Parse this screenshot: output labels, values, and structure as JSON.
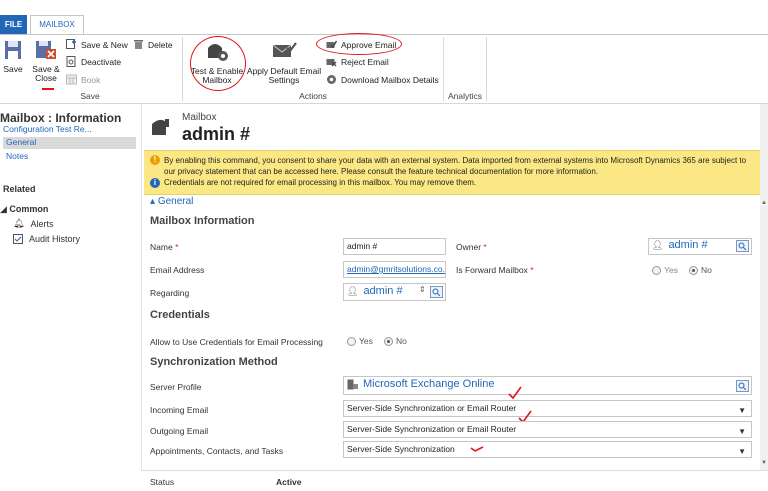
{
  "tabs": {
    "file": "FILE",
    "mailbox": "MAILBOX"
  },
  "ribbon": {
    "save": "Save",
    "save_close_1": "Save &",
    "save_close_2": "Close",
    "save_new": "Save & New",
    "delete": "Delete",
    "deactivate": "Deactivate",
    "book": "Book",
    "group_save": "Save",
    "test_enable_1": "Test & Enable",
    "test_enable_2": "Mailbox",
    "apply_default_1": "Apply Default Email",
    "apply_default_2": "Settings",
    "approve_email": "Approve Email",
    "reject_email": "Reject Email",
    "download_details": "Download Mailbox Details",
    "group_actions": "Actions",
    "group_analytics": "Analytics"
  },
  "nav": {
    "title": "Mailbox : Information",
    "config": "Configuration Test Re...",
    "general": "General",
    "notes": "Notes",
    "related": "Related",
    "common": "Common",
    "alerts": "Alerts",
    "audit": "Audit History"
  },
  "header": {
    "entity": "Mailbox",
    "name": "admin #"
  },
  "notice": {
    "line1a": "By enabling this command, you consent to share your data with an external system. Data imported from external systems into Microsoft Dynamics 365 are",
    "line1b": "subject to our privacy statement that can be accessed ",
    "here": "here",
    "line1c": ". Please consult the feature technical documentation for ",
    "more": "more information",
    "line1d": ".",
    "line2": "Credentials are not required for email processing in this mailbox. You may remove them."
  },
  "form": {
    "general": "General",
    "mailbox_info": "Mailbox Information",
    "name_label": "Name",
    "name_value": "admin #",
    "owner_label": "Owner",
    "owner_value": "admin #",
    "email_label": "Email Address",
    "email_value": "admin@gmritsolutions.co.",
    "forward_label": "Is Forward Mailbox",
    "yes": "Yes",
    "no": "No",
    "regarding_label": "Regarding",
    "regarding_value": "admin #",
    "credentials": "Credentials",
    "allow_label": "Allow to Use Credentials for Email Processing",
    "sync_method": "Synchronization Method",
    "server_profile_label": "Server Profile",
    "server_profile_value": "Microsoft Exchange Online",
    "incoming_label": "Incoming Email",
    "incoming_value": "Server-Side Synchronization or Email Router",
    "outgoing_label": "Outgoing Email",
    "outgoing_value": "Server-Side Synchronization or Email Router",
    "appts_label": "Appointments, Contacts, and Tasks",
    "appts_value": "Server-Side Synchronization"
  },
  "footer": {
    "status_label": "Status",
    "status_value": "Active"
  },
  "colors": {
    "accent": "#2266b8",
    "annotation": "#e0141d",
    "notice": "#fbe885"
  }
}
